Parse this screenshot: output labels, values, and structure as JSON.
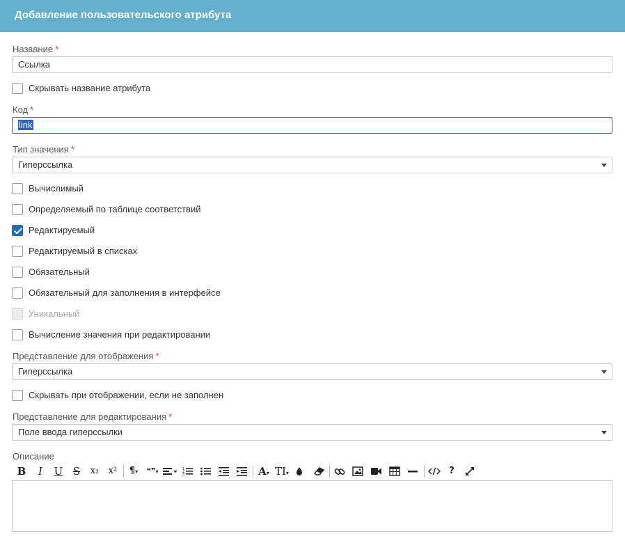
{
  "header": {
    "title": "Добавление пользовательского атрибута"
  },
  "required_mark": "*",
  "fields": {
    "name": {
      "label": "Название",
      "value": "Ссылка"
    },
    "hide_name": {
      "label": "Скрывать название атрибута",
      "checked": false
    },
    "code": {
      "label": "Код",
      "value": "link"
    },
    "value_type": {
      "label": "Тип значения",
      "value": "Гиперссылка"
    },
    "display_view": {
      "label": "Представление для отображения",
      "value": "Гиперссылка"
    },
    "hide_empty": {
      "label": "Скрывать при отображении, если не заполнен",
      "checked": false
    },
    "edit_view": {
      "label": "Представление для редактирования",
      "value": "Поле ввода гиперссылки"
    },
    "description": {
      "label": "Описание",
      "value": ""
    }
  },
  "flags": [
    {
      "label": "Вычислимый",
      "checked": false,
      "disabled": false
    },
    {
      "label": "Определяемый по таблице соответствий",
      "checked": false,
      "disabled": false
    },
    {
      "label": "Редактируемый",
      "checked": true,
      "disabled": false
    },
    {
      "label": "Редактируемый в списках",
      "checked": false,
      "disabled": false
    },
    {
      "label": "Обязательный",
      "checked": false,
      "disabled": false
    },
    {
      "label": "Обязательный для заполнения в интерфейсе",
      "checked": false,
      "disabled": false
    },
    {
      "label": "Уникальный",
      "checked": false,
      "disabled": true
    },
    {
      "label": "Вычисление значения при редактировании",
      "checked": false,
      "disabled": false
    }
  ],
  "toolbar": {
    "bold": "B",
    "italic": "I",
    "underline": "U",
    "strike": "S",
    "subscript": "x₂",
    "superscript": "x²",
    "paragraph": "¶",
    "quote": "❝❞",
    "font_size": "A",
    "text_height": "TI",
    "help": "?",
    "icons": [
      "bold-icon",
      "italic-icon",
      "underline-icon",
      "strikethrough-icon",
      "subscript-icon",
      "superscript-icon",
      "paragraph-format-icon",
      "quote-icon",
      "align-icon",
      "ordered-list-icon",
      "unordered-list-icon",
      "outdent-icon",
      "indent-icon",
      "font-size-icon",
      "line-height-icon",
      "color-icon",
      "clear-format-icon",
      "link-icon",
      "image-icon",
      "video-icon",
      "table-icon",
      "horizontal-line-icon",
      "code-view-icon",
      "help-icon",
      "fullscreen-icon"
    ]
  }
}
